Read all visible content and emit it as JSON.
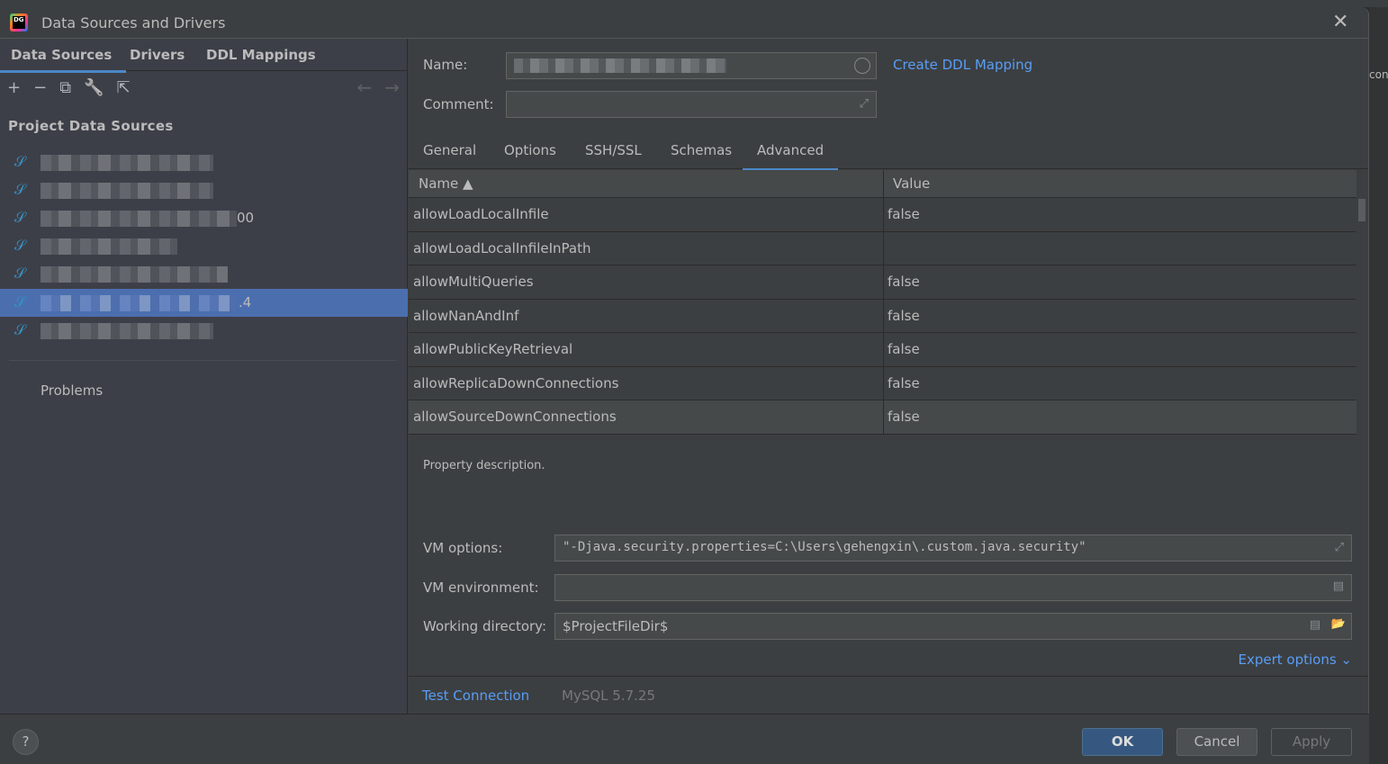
{
  "window": {
    "title": "Data Sources and Drivers",
    "logo_text": "DG"
  },
  "background": {
    "ide_fragment": "con"
  },
  "left": {
    "tabs": [
      {
        "label": "Data Sources",
        "active": true
      },
      {
        "label": "Drivers"
      },
      {
        "label": "DDL Mappings"
      }
    ],
    "toolbar": {
      "add": "+",
      "remove": "−",
      "copy": "⧉",
      "wrench": "🔧",
      "export": "⇱",
      "back": "←",
      "forward": "→"
    },
    "section_title": "Project Data Sources",
    "data_sources": [
      {
        "icon": "mysql-icon",
        "tail": ""
      },
      {
        "icon": "mysql-icon",
        "tail": ""
      },
      {
        "icon": "mysql-icon",
        "tail": "00"
      },
      {
        "icon": "mysql-icon",
        "tail": ""
      },
      {
        "icon": "mysql-icon",
        "tail": ""
      },
      {
        "icon": "mysql-icon",
        "tail": ".4",
        "selected": true
      },
      {
        "icon": "mysql-icon",
        "tail": ""
      }
    ],
    "problems": "Problems"
  },
  "right": {
    "name_label": "Name:",
    "comment_label": "Comment:",
    "create_ddl": "Create DDL Mapping",
    "tabs": [
      {
        "label": "General"
      },
      {
        "label": "Options"
      },
      {
        "label": "SSH/SSL"
      },
      {
        "label": "Schemas"
      },
      {
        "label": "Advanced",
        "active": true
      }
    ],
    "table": {
      "headers": {
        "name": "Name ▲",
        "value": "Value"
      },
      "rows": [
        {
          "name": "allowLoadLocalInfile",
          "value": "false"
        },
        {
          "name": "allowLoadLocalInfileInPath",
          "value": ""
        },
        {
          "name": "allowMultiQueries",
          "value": "false"
        },
        {
          "name": "allowNanAndInf",
          "value": "false"
        },
        {
          "name": "allowPublicKeyRetrieval",
          "value": "false"
        },
        {
          "name": "allowReplicaDownConnections",
          "value": "false"
        },
        {
          "name": "allowSourceDownConnections",
          "value": "false"
        }
      ]
    },
    "description": "Property description.",
    "vm_options_label": "VM options:",
    "vm_options_value": "\"-Djava.security.properties=C:\\Users\\gehengxin\\.custom.java.security\"",
    "vm_env_label": "VM environment:",
    "vm_env_value": "",
    "workdir_label": "Working directory:",
    "workdir_value": "$ProjectFileDir$",
    "expert_options": "Expert options ⌄",
    "test_connection": "Test Connection",
    "driver_version": "MySQL 5.7.25"
  },
  "buttons": {
    "help": "?",
    "ok": "OK",
    "cancel": "Cancel",
    "apply": "Apply"
  },
  "colors": {
    "accent": "#4a88c7",
    "selection": "#4b6eaf",
    "link": "#589df6",
    "ok_button": "#365880"
  }
}
